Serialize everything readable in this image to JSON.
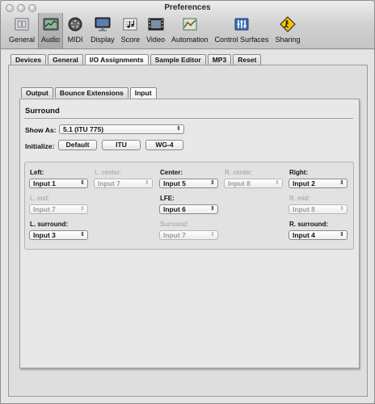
{
  "window": {
    "title": "Preferences"
  },
  "toolbar": {
    "items": [
      {
        "label": "General",
        "icon": "general-icon"
      },
      {
        "label": "Audio",
        "icon": "audio-icon",
        "selected": true
      },
      {
        "label": "MIDI",
        "icon": "midi-icon"
      },
      {
        "label": "Display",
        "icon": "display-icon"
      },
      {
        "label": "Score",
        "icon": "score-icon"
      },
      {
        "label": "Video",
        "icon": "video-icon"
      },
      {
        "label": "Automation",
        "icon": "automation-icon"
      },
      {
        "label": "Control Surfaces",
        "icon": "control-surfaces-icon"
      },
      {
        "label": "Sharing",
        "icon": "sharing-icon"
      }
    ]
  },
  "tabs": [
    "Devices",
    "General",
    "I/O Assignments",
    "Sample Editor",
    "MP3",
    "Reset"
  ],
  "active_tab": "I/O Assignments",
  "subtabs": [
    "Output",
    "Bounce Extensions",
    "Input"
  ],
  "active_subtab": "Input",
  "surround": {
    "title": "Surround",
    "show_as_label": "Show As:",
    "show_as_value": "5.1 (ITU 775)",
    "initialize_label": "Initialize:",
    "init_buttons": [
      "Default",
      "ITU",
      "WG-4"
    ]
  },
  "channels": {
    "left": {
      "label": "Left:",
      "value": "Input 1",
      "enabled": true
    },
    "l_center": {
      "label": "L. center:",
      "value": "Input 7",
      "enabled": false
    },
    "center": {
      "label": "Center:",
      "value": "Input 5",
      "enabled": true
    },
    "r_center": {
      "label": "R. center:",
      "value": "Input 8",
      "enabled": false
    },
    "right": {
      "label": "Right:",
      "value": "Input 2",
      "enabled": true
    },
    "l_mid": {
      "label": "L. mid:",
      "value": "Input 7",
      "enabled": false
    },
    "lfe": {
      "label": "LFE:",
      "value": "Input 6",
      "enabled": true
    },
    "r_mid": {
      "label": "R. mid:",
      "value": "Input 8",
      "enabled": false
    },
    "l_surround": {
      "label": "L. surround:",
      "value": "Input 3",
      "enabled": true
    },
    "surround": {
      "label": "Surround:",
      "value": "Input 7",
      "enabled": false
    },
    "r_surround": {
      "label": "R. surround:",
      "value": "Input 4",
      "enabled": true
    }
  }
}
